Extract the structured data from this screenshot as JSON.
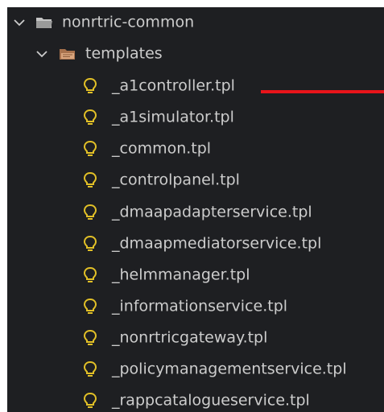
{
  "explorer": {
    "root_folder": {
      "label": "nonrtric-common",
      "expanded": true
    },
    "sub_folder": {
      "label": "templates",
      "expanded": true
    },
    "files": [
      {
        "label": "_a1controller.tpl",
        "icon": "lightbulb-icon"
      },
      {
        "label": "_a1simulator.tpl",
        "icon": "lightbulb-icon"
      },
      {
        "label": "_common.tpl",
        "icon": "lightbulb-icon"
      },
      {
        "label": "_controlpanel.tpl",
        "icon": "lightbulb-icon"
      },
      {
        "label": "_dmaapadapterservice.tpl",
        "icon": "lightbulb-icon"
      },
      {
        "label": "_dmaapmediatorservice.tpl",
        "icon": "lightbulb-icon"
      },
      {
        "label": "_helmmanager.tpl",
        "icon": "lightbulb-icon"
      },
      {
        "label": "_informationservice.tpl",
        "icon": "lightbulb-icon"
      },
      {
        "label": "_nonrtricgateway.tpl",
        "icon": "lightbulb-icon"
      },
      {
        "label": "_policymanagementservice.tpl",
        "icon": "lightbulb-icon"
      },
      {
        "label": "_rappcatalogueservice.tpl",
        "icon": "lightbulb-icon"
      }
    ]
  },
  "colors": {
    "background": "#1e1f22",
    "text": "#cccccc",
    "folder_icon": "#c5c5c5",
    "template_folder_icon": "#a8724d",
    "lightbulb_icon": "#e2c027",
    "annotation_line": "#e8141a"
  }
}
